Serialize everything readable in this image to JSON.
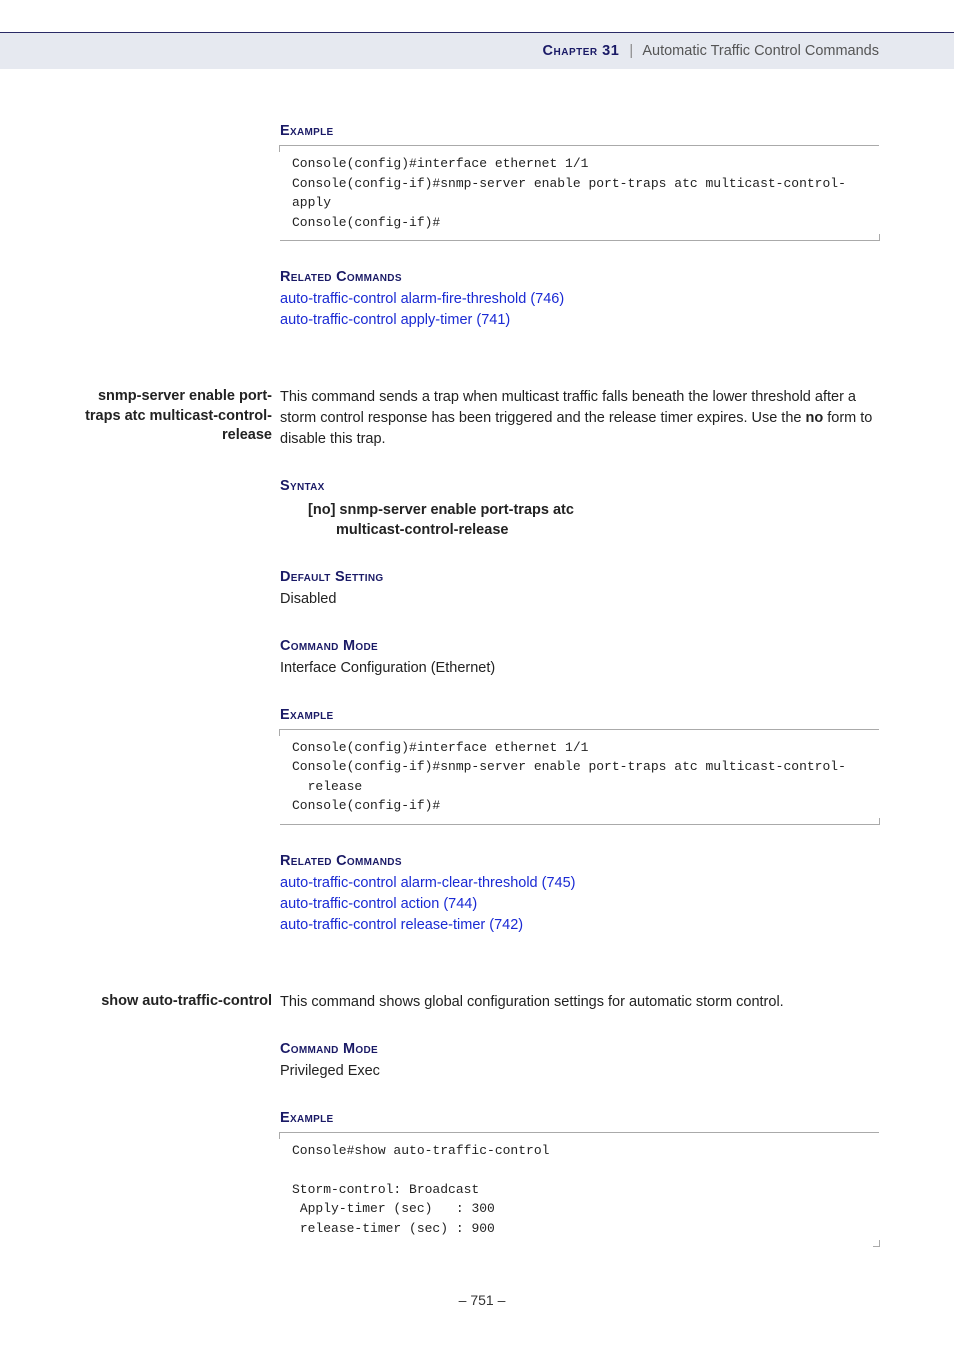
{
  "header": {
    "chapter_label": "Chapter 31",
    "divider": "|",
    "section_title": "Automatic Traffic Control Commands"
  },
  "sec1": {
    "example_label": "Example",
    "example_code": "Console(config)#interface ethernet 1/1\nConsole(config-if)#snmp-server enable port-traps atc multicast-control-apply\nConsole(config-if)#",
    "related_label": "Related Commands",
    "related_links": [
      "auto-traffic-control alarm-fire-threshold (746)",
      "auto-traffic-control apply-timer (741)"
    ]
  },
  "sec2": {
    "sidetitle": "snmp-server enable port-traps atc multicast-control-release",
    "desc_pre": "This command sends a trap when multicast traffic falls beneath the lower threshold after a storm control response has been triggered and the release timer expires. Use the ",
    "desc_bold": "no",
    "desc_post": " form to disable this trap.",
    "syntax_label": "Syntax",
    "syntax_line1_pre": "[",
    "syntax_line1_no": "no",
    "syntax_line1_post": "] snmp-server enable port-traps atc",
    "syntax_line2": "multicast-control-release",
    "default_label": "Default Setting",
    "default_value": "Disabled",
    "mode_label": "Command Mode",
    "mode_value": "Interface Configuration (Ethernet)",
    "example_label": "Example",
    "example_code": "Console(config)#interface ethernet 1/1\nConsole(config-if)#snmp-server enable port-traps atc multicast-control-\n  release\nConsole(config-if)#",
    "related_label": "Related Commands",
    "related_links": [
      "auto-traffic-control alarm-clear-threshold (745)",
      "auto-traffic-control action (744)",
      "auto-traffic-control release-timer (742)"
    ]
  },
  "sec3": {
    "sidetitle": "show auto-traffic-control",
    "desc": "This command shows global configuration settings for automatic storm control.",
    "mode_label": "Command Mode",
    "mode_value": "Privileged Exec",
    "example_label": "Example",
    "example_code": "Console#show auto-traffic-control\n\nStorm-control: Broadcast\n Apply-timer (sec)   : 300\n release-timer (sec) : 900"
  },
  "footer": {
    "page_number": "– 751 –"
  }
}
